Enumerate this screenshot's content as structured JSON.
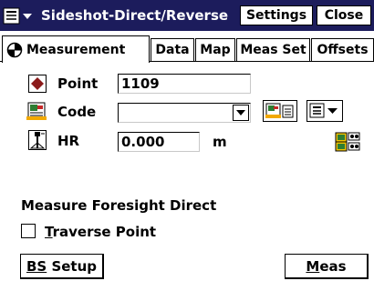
{
  "window": {
    "title": "Sideshot-Direct/Reverse",
    "settings_label": "Settings",
    "close_label": "Close"
  },
  "tabs": [
    {
      "label": "Measurement",
      "active": true
    },
    {
      "label": "Data",
      "active": false
    },
    {
      "label": "Map",
      "active": false
    },
    {
      "label": "Meas Set",
      "active": false
    },
    {
      "label": "Offsets",
      "active": false
    }
  ],
  "form": {
    "point_label": "Point",
    "point_value": "1109",
    "code_label": "Code",
    "code_value": "",
    "hr_label": "HR",
    "hr_value": "0.000",
    "hr_unit": "m"
  },
  "status": {
    "message": "Measure Foresight Direct"
  },
  "traverse": {
    "label_first": "T",
    "label_rest": "raverse Point",
    "checked": false
  },
  "buttons": {
    "bs_setup_first": "BS",
    "bs_setup_rest": " Setup",
    "meas_first": "M",
    "meas_rest": "eas"
  },
  "colors": {
    "titlebar": "#1c1c5c",
    "point_icon": "#8b1a1a"
  }
}
